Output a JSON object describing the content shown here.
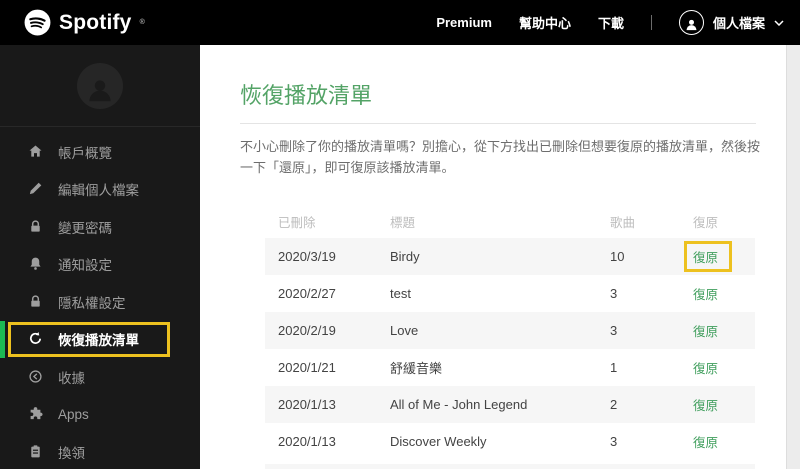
{
  "colors": {
    "topbar-bg": "#000000",
    "sidebar-bg": "#191919",
    "accent-green": "#1db954",
    "title-green": "#53a366",
    "link-green": "#3f9e5c",
    "highlight-yellow": "#edc11f"
  },
  "topbar": {
    "logo_text": "Spotify",
    "logo_mark": "®",
    "nav": [
      {
        "key": "premium",
        "label": "Premium"
      },
      {
        "key": "help-center",
        "label": "幫助中心"
      },
      {
        "key": "download",
        "label": "下載"
      }
    ],
    "profile_label": "個人檔案"
  },
  "sidebar": {
    "items": [
      {
        "key": "account-overview",
        "icon": "home-icon",
        "label": "帳戶概覽"
      },
      {
        "key": "edit-profile",
        "icon": "pencil-icon",
        "label": "編輯個人檔案"
      },
      {
        "key": "change-password",
        "icon": "lock-icon",
        "label": "變更密碼"
      },
      {
        "key": "notification-settings",
        "icon": "bell-icon",
        "label": "通知設定"
      },
      {
        "key": "privacy-settings",
        "icon": "lock-icon",
        "label": "隱私權設定"
      },
      {
        "key": "restore-playlists",
        "icon": "restore-icon",
        "label": "恢復播放清單",
        "active": true
      },
      {
        "key": "receipts",
        "icon": "receipt-icon",
        "label": "收據"
      },
      {
        "key": "apps",
        "icon": "puzzle-icon",
        "label": "Apps"
      },
      {
        "key": "redeem",
        "icon": "redeem-icon",
        "label": "換領"
      }
    ]
  },
  "main": {
    "title": "恢復播放清單",
    "description": "不小心刪除了你的播放清單嗎？別擔心，從下方找出已刪除但想要復原的播放清單，然後按一下「還原」，即可復原該播放清單。",
    "table": {
      "headers": [
        "已刪除",
        "標題",
        "歌曲",
        "復原"
      ],
      "rows": [
        {
          "deleted": "2020/3/19",
          "title": "Birdy",
          "songs": "10",
          "action": "復原",
          "highlighted": true
        },
        {
          "deleted": "2020/2/27",
          "title": "test",
          "songs": "3",
          "action": "復原"
        },
        {
          "deleted": "2020/2/19",
          "title": "Love",
          "songs": "3",
          "action": "復原"
        },
        {
          "deleted": "2020/1/21",
          "title": "舒緩音樂",
          "songs": "1",
          "action": "復原"
        },
        {
          "deleted": "2020/1/13",
          "title": "All of Me - John Legend",
          "songs": "2",
          "action": "復原"
        },
        {
          "deleted": "2020/1/13",
          "title": "Discover Weekly",
          "songs": "3",
          "action": "復原"
        }
      ]
    }
  }
}
